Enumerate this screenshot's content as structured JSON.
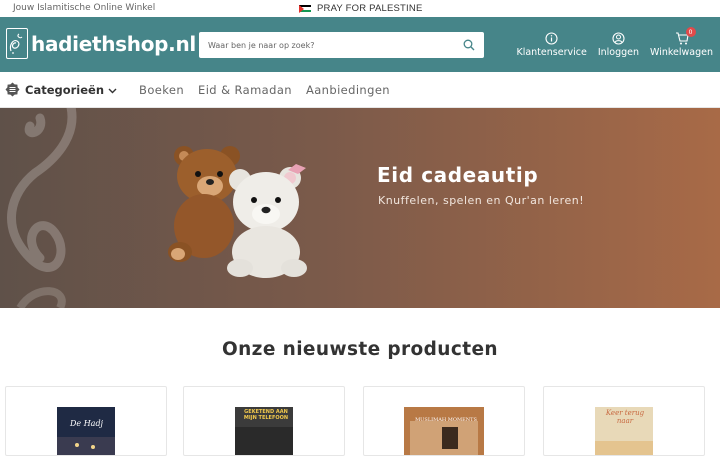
{
  "topbar": {
    "tagline": "Jouw Islamitische Online Winkel",
    "announcement": "PRAY FOR PALESTINE",
    "flag_icon": "palestine-flag-icon"
  },
  "header": {
    "logo_text": "hadiethshop.nl",
    "search_placeholder": "Waar ben je naar op zoek?",
    "nav": [
      {
        "label": "Klantenservice",
        "icon": "info-icon"
      },
      {
        "label": "Inloggen",
        "icon": "user-icon"
      },
      {
        "label": "Winkelwagen",
        "icon": "cart-icon",
        "badge": "0"
      }
    ],
    "colors": {
      "header_bg": "#468589",
      "badge": "#e24a4a"
    }
  },
  "menu": {
    "categories_label": "Categorieën",
    "links": [
      "Boeken",
      "Eid & Ramadan",
      "Aanbiedingen"
    ]
  },
  "banner": {
    "title": "Eid cadeautip",
    "subtitle": "Knuffelen, spelen en Qur'an leren!"
  },
  "products": {
    "title": "Onze nieuwste producten",
    "items": [
      {
        "cover_text": "De Hadj",
        "cover_color": "#1f2a44"
      },
      {
        "cover_text": "GEKETEND AAN MIJN TELEFOON",
        "cover_color": "#3b3b3b"
      },
      {
        "cover_text": "MUSLIMAH MOMENTS",
        "cover_color": "#b87945"
      },
      {
        "cover_text": "Keer terug naar",
        "cover_color": "#e8d9b8"
      }
    ]
  }
}
